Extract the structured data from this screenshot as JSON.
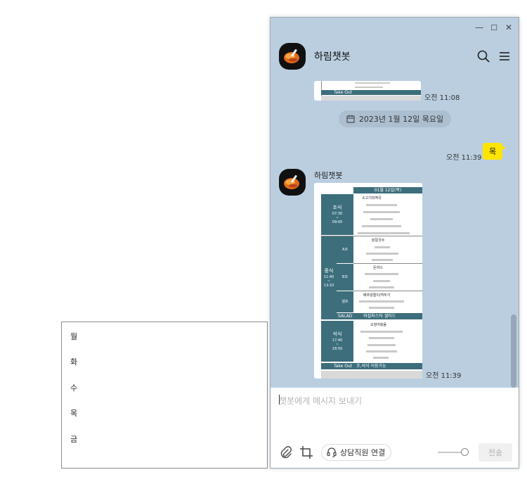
{
  "days": {
    "items": [
      "월",
      "화",
      "수",
      "목",
      "금"
    ]
  },
  "chat": {
    "bot_name": "하림챗봇",
    "window_controls": {
      "minimize": "—",
      "maximize": "☐",
      "close": "✕"
    },
    "messages": {
      "top_image_time": "오전 11:08",
      "top_image_takeout": "Take Out",
      "date_divider": "2023년 1월 12일 목요일",
      "my_message": "목",
      "my_message_time": "오전 11:39",
      "sender_name": "하림챗봇",
      "menu_image_time": "오전 11:39"
    },
    "menu_image": {
      "date_header": "01월 12일(목)",
      "breakfast_label": "조식",
      "breakfast_time": "07:30 ~ 09:00",
      "lunch_label": "중식",
      "lunch_time": "11:40 ~ 13:10",
      "dinner_label": "석식",
      "dinner_time": "17:40 ~ 18:50",
      "corner_a": "A코",
      "corner_b": "B코",
      "corner_self": "셀프",
      "salad": "SALAD",
      "salad_menu": "바질파스타 샐러드",
      "takeout": "Take Out",
      "takeout_note": "조,석식 이용가능",
      "breakfast_main": "소고기미역국",
      "lunch_a_main": "닭칼국수",
      "lunch_b_main": "돈까스",
      "lunch_self_main": "베추겉절이/깍두기",
      "dinner_main": "오징어볶음"
    },
    "input": {
      "placeholder": "챗봇에게 메시지 보내기",
      "agent_button": "상담직원 연결",
      "send_button": "전송"
    }
  }
}
